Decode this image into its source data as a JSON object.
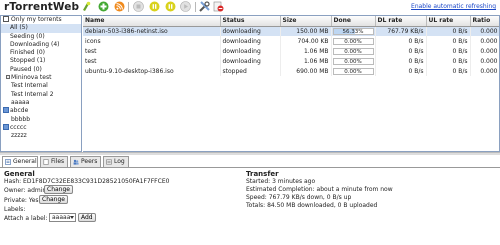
{
  "app": {
    "title": "rTorrentWeb",
    "refresh_link": "Enable automatic refreshing"
  },
  "toolbar": {
    "buttons": [
      "add-icon",
      "add-plus-icon",
      "rss-icon",
      "stop-icon",
      "pause-icon",
      "start-icon",
      "settings-icon",
      "remove-icon"
    ]
  },
  "sidebar": {
    "only_my_torrents": "Only my torrents",
    "filters": [
      "All (5)",
      "Seeding (0)",
      "Downloading (4)",
      "Finished (0)",
      "Stopped (1)",
      "Paused (0)"
    ],
    "trackers": [
      {
        "name": "Mininova test",
        "subs": [
          "Test Internal",
          "Test Internal 2",
          "aaaaa"
        ]
      },
      {
        "name": "abcde",
        "subs": [
          "bbbbb"
        ]
      },
      {
        "name": "ccccc",
        "subs": [
          "zzzzz"
        ]
      }
    ]
  },
  "table": {
    "headers": [
      "Name",
      "Status",
      "Size",
      "Done",
      "DL rate",
      "UL rate",
      "Ratio"
    ],
    "rows": [
      {
        "name": "debian-503-i386-netinst.iso",
        "status": "downloading",
        "size": "150.00 MB",
        "done": "56.33%",
        "done_pct": 56.33,
        "dl": "767.79 KB/s",
        "ul": "0 B/s",
        "ratio": "0.000"
      },
      {
        "name": "icons",
        "status": "downloading",
        "size": "704.00 KB",
        "done": "0.00%",
        "done_pct": 0,
        "dl": "0 B/s",
        "ul": "0 B/s",
        "ratio": "0.000"
      },
      {
        "name": "test",
        "status": "downloading",
        "size": "1.06 MB",
        "done": "0.00%",
        "done_pct": 0,
        "dl": "0 B/s",
        "ul": "0 B/s",
        "ratio": "0.000"
      },
      {
        "name": "test",
        "status": "downloading",
        "size": "1.06 MB",
        "done": "0.00%",
        "done_pct": 0,
        "dl": "0 B/s",
        "ul": "0 B/s",
        "ratio": "0.000"
      },
      {
        "name": "ubuntu-9.10-desktop-i386.iso",
        "status": "stopped",
        "size": "690.00 MB",
        "done": "0.00%",
        "done_pct": 0,
        "dl": "0 B/s",
        "ul": "0 B/s",
        "ratio": "0.000"
      }
    ]
  },
  "tabs": [
    "General",
    "Files",
    "Peers",
    "Log"
  ],
  "details": {
    "general": {
      "title": "General",
      "hash": "Hash: ED1F8D7C32EE833C931D28521050FA1F7FFCE0",
      "owner_label": "Owner: admin",
      "change_label": "Change",
      "private_label": "Private: Yes",
      "labels_label": "Labels:",
      "attach_label": "Attach a label:",
      "attach_value": "aaaaa",
      "add_label": "Add"
    },
    "transfer": {
      "title": "Transfer",
      "started": "Started: 3 minutes ago",
      "completion": "Estimated Completion: about a minute from now",
      "speed": "Speed: 767.79 KB/s down, 0 B/s up",
      "totals": "Totals: 84.50 MB downloaded, 0 B uploaded"
    }
  },
  "colors": {
    "selection": "#d4e2f4",
    "link": "#1a47c8",
    "progress": "#bdd6f2"
  }
}
